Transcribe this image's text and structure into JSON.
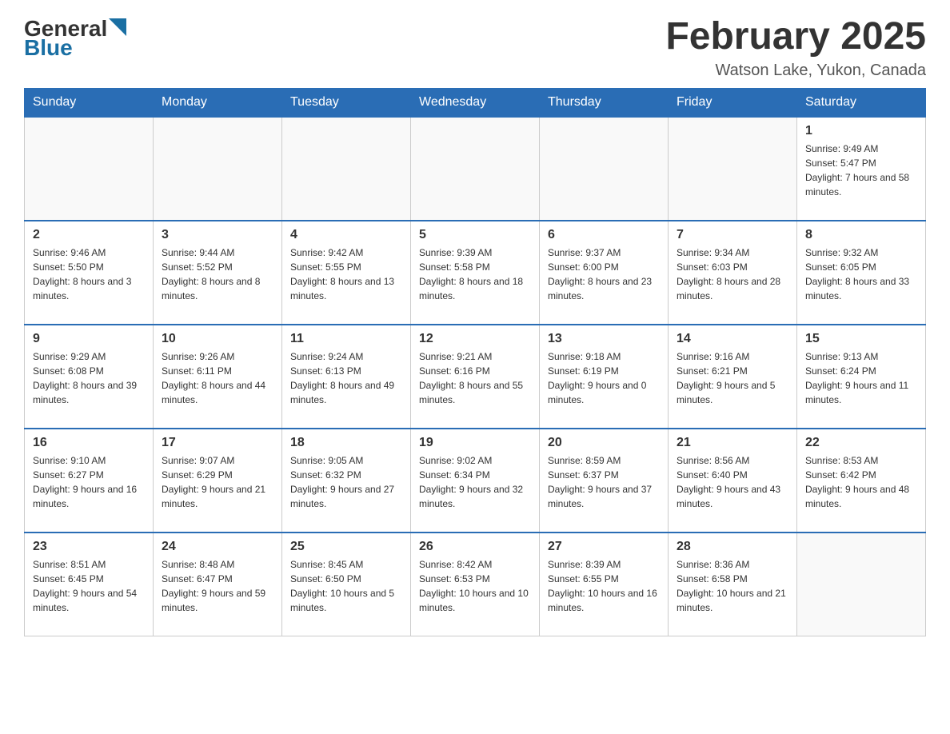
{
  "header": {
    "logo_general": "General",
    "logo_blue": "Blue",
    "month_title": "February 2025",
    "location": "Watson Lake, Yukon, Canada"
  },
  "days_of_week": [
    "Sunday",
    "Monday",
    "Tuesday",
    "Wednesday",
    "Thursday",
    "Friday",
    "Saturday"
  ],
  "weeks": [
    [
      {
        "day": "",
        "info": ""
      },
      {
        "day": "",
        "info": ""
      },
      {
        "day": "",
        "info": ""
      },
      {
        "day": "",
        "info": ""
      },
      {
        "day": "",
        "info": ""
      },
      {
        "day": "",
        "info": ""
      },
      {
        "day": "1",
        "info": "Sunrise: 9:49 AM\nSunset: 5:47 PM\nDaylight: 7 hours and 58 minutes."
      }
    ],
    [
      {
        "day": "2",
        "info": "Sunrise: 9:46 AM\nSunset: 5:50 PM\nDaylight: 8 hours and 3 minutes."
      },
      {
        "day": "3",
        "info": "Sunrise: 9:44 AM\nSunset: 5:52 PM\nDaylight: 8 hours and 8 minutes."
      },
      {
        "day": "4",
        "info": "Sunrise: 9:42 AM\nSunset: 5:55 PM\nDaylight: 8 hours and 13 minutes."
      },
      {
        "day": "5",
        "info": "Sunrise: 9:39 AM\nSunset: 5:58 PM\nDaylight: 8 hours and 18 minutes."
      },
      {
        "day": "6",
        "info": "Sunrise: 9:37 AM\nSunset: 6:00 PM\nDaylight: 8 hours and 23 minutes."
      },
      {
        "day": "7",
        "info": "Sunrise: 9:34 AM\nSunset: 6:03 PM\nDaylight: 8 hours and 28 minutes."
      },
      {
        "day": "8",
        "info": "Sunrise: 9:32 AM\nSunset: 6:05 PM\nDaylight: 8 hours and 33 minutes."
      }
    ],
    [
      {
        "day": "9",
        "info": "Sunrise: 9:29 AM\nSunset: 6:08 PM\nDaylight: 8 hours and 39 minutes."
      },
      {
        "day": "10",
        "info": "Sunrise: 9:26 AM\nSunset: 6:11 PM\nDaylight: 8 hours and 44 minutes."
      },
      {
        "day": "11",
        "info": "Sunrise: 9:24 AM\nSunset: 6:13 PM\nDaylight: 8 hours and 49 minutes."
      },
      {
        "day": "12",
        "info": "Sunrise: 9:21 AM\nSunset: 6:16 PM\nDaylight: 8 hours and 55 minutes."
      },
      {
        "day": "13",
        "info": "Sunrise: 9:18 AM\nSunset: 6:19 PM\nDaylight: 9 hours and 0 minutes."
      },
      {
        "day": "14",
        "info": "Sunrise: 9:16 AM\nSunset: 6:21 PM\nDaylight: 9 hours and 5 minutes."
      },
      {
        "day": "15",
        "info": "Sunrise: 9:13 AM\nSunset: 6:24 PM\nDaylight: 9 hours and 11 minutes."
      }
    ],
    [
      {
        "day": "16",
        "info": "Sunrise: 9:10 AM\nSunset: 6:27 PM\nDaylight: 9 hours and 16 minutes."
      },
      {
        "day": "17",
        "info": "Sunrise: 9:07 AM\nSunset: 6:29 PM\nDaylight: 9 hours and 21 minutes."
      },
      {
        "day": "18",
        "info": "Sunrise: 9:05 AM\nSunset: 6:32 PM\nDaylight: 9 hours and 27 minutes."
      },
      {
        "day": "19",
        "info": "Sunrise: 9:02 AM\nSunset: 6:34 PM\nDaylight: 9 hours and 32 minutes."
      },
      {
        "day": "20",
        "info": "Sunrise: 8:59 AM\nSunset: 6:37 PM\nDaylight: 9 hours and 37 minutes."
      },
      {
        "day": "21",
        "info": "Sunrise: 8:56 AM\nSunset: 6:40 PM\nDaylight: 9 hours and 43 minutes."
      },
      {
        "day": "22",
        "info": "Sunrise: 8:53 AM\nSunset: 6:42 PM\nDaylight: 9 hours and 48 minutes."
      }
    ],
    [
      {
        "day": "23",
        "info": "Sunrise: 8:51 AM\nSunset: 6:45 PM\nDaylight: 9 hours and 54 minutes."
      },
      {
        "day": "24",
        "info": "Sunrise: 8:48 AM\nSunset: 6:47 PM\nDaylight: 9 hours and 59 minutes."
      },
      {
        "day": "25",
        "info": "Sunrise: 8:45 AM\nSunset: 6:50 PM\nDaylight: 10 hours and 5 minutes."
      },
      {
        "day": "26",
        "info": "Sunrise: 8:42 AM\nSunset: 6:53 PM\nDaylight: 10 hours and 10 minutes."
      },
      {
        "day": "27",
        "info": "Sunrise: 8:39 AM\nSunset: 6:55 PM\nDaylight: 10 hours and 16 minutes."
      },
      {
        "day": "28",
        "info": "Sunrise: 8:36 AM\nSunset: 6:58 PM\nDaylight: 10 hours and 21 minutes."
      },
      {
        "day": "",
        "info": ""
      }
    ]
  ]
}
